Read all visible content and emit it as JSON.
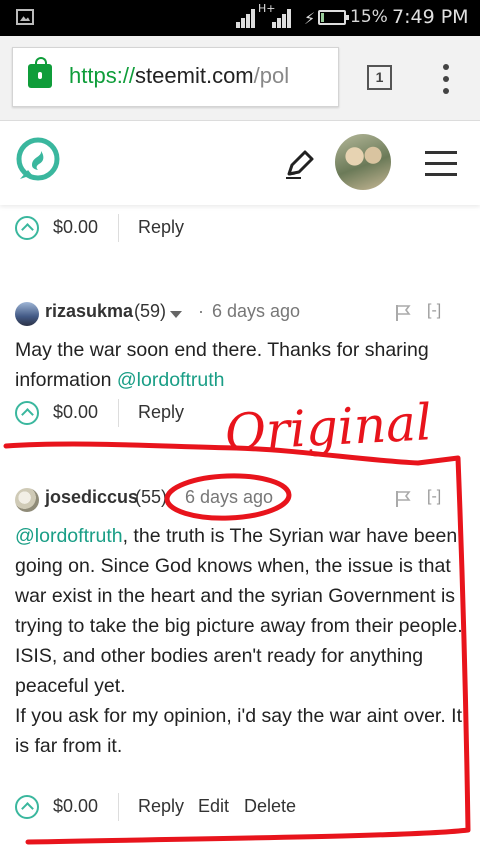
{
  "status_bar": {
    "network_label": "H+",
    "battery_percent": "15%",
    "battery_level": 0.15,
    "time": "7:49 PM"
  },
  "browser": {
    "url_scheme": "https",
    "url_sep": "://",
    "url_host": "steemit.com",
    "url_path": "/pol",
    "tab_count": "1"
  },
  "site": {
    "icons": [
      "steemit-logo",
      "pen-icon",
      "avatar",
      "hamburger-icon"
    ]
  },
  "comments": [
    {
      "payout": "$0.00",
      "reply_label": "Reply"
    },
    {
      "author": "rizasukma",
      "reputation": "(59)",
      "time_sep": "·",
      "time": "6 days ago",
      "collapse": "[-]",
      "body_text": "May the war soon end there. Thanks for sharing information ",
      "mention": "@lordoftruth",
      "payout": "$0.00",
      "reply_label": "Reply"
    },
    {
      "author": "josediccus",
      "reputation": "(55)",
      "time": "6 days ago",
      "collapse": "[-]",
      "mention": "@lordoftruth",
      "body_p1_rest": ", the truth is The Syrian war have been going on. Since God knows when, the issue is that war exist in the heart and the syrian Government is trying to take the big picture away from their people.",
      "body_p2": "ISIS, and other bodies aren't ready for anything peaceful yet.",
      "body_p3": "If you ask for my opinion, i'd say the war aint over. It is far from it.",
      "payout": "$0.00",
      "reply_label": "Reply",
      "edit_label": "Edit",
      "delete_label": "Delete"
    }
  ],
  "annotation": {
    "label": "Original",
    "color": "#e8141c"
  },
  "colors": {
    "accent": "#3ab79e",
    "link": "#1a9e86",
    "secure": "#0f9d3a"
  }
}
